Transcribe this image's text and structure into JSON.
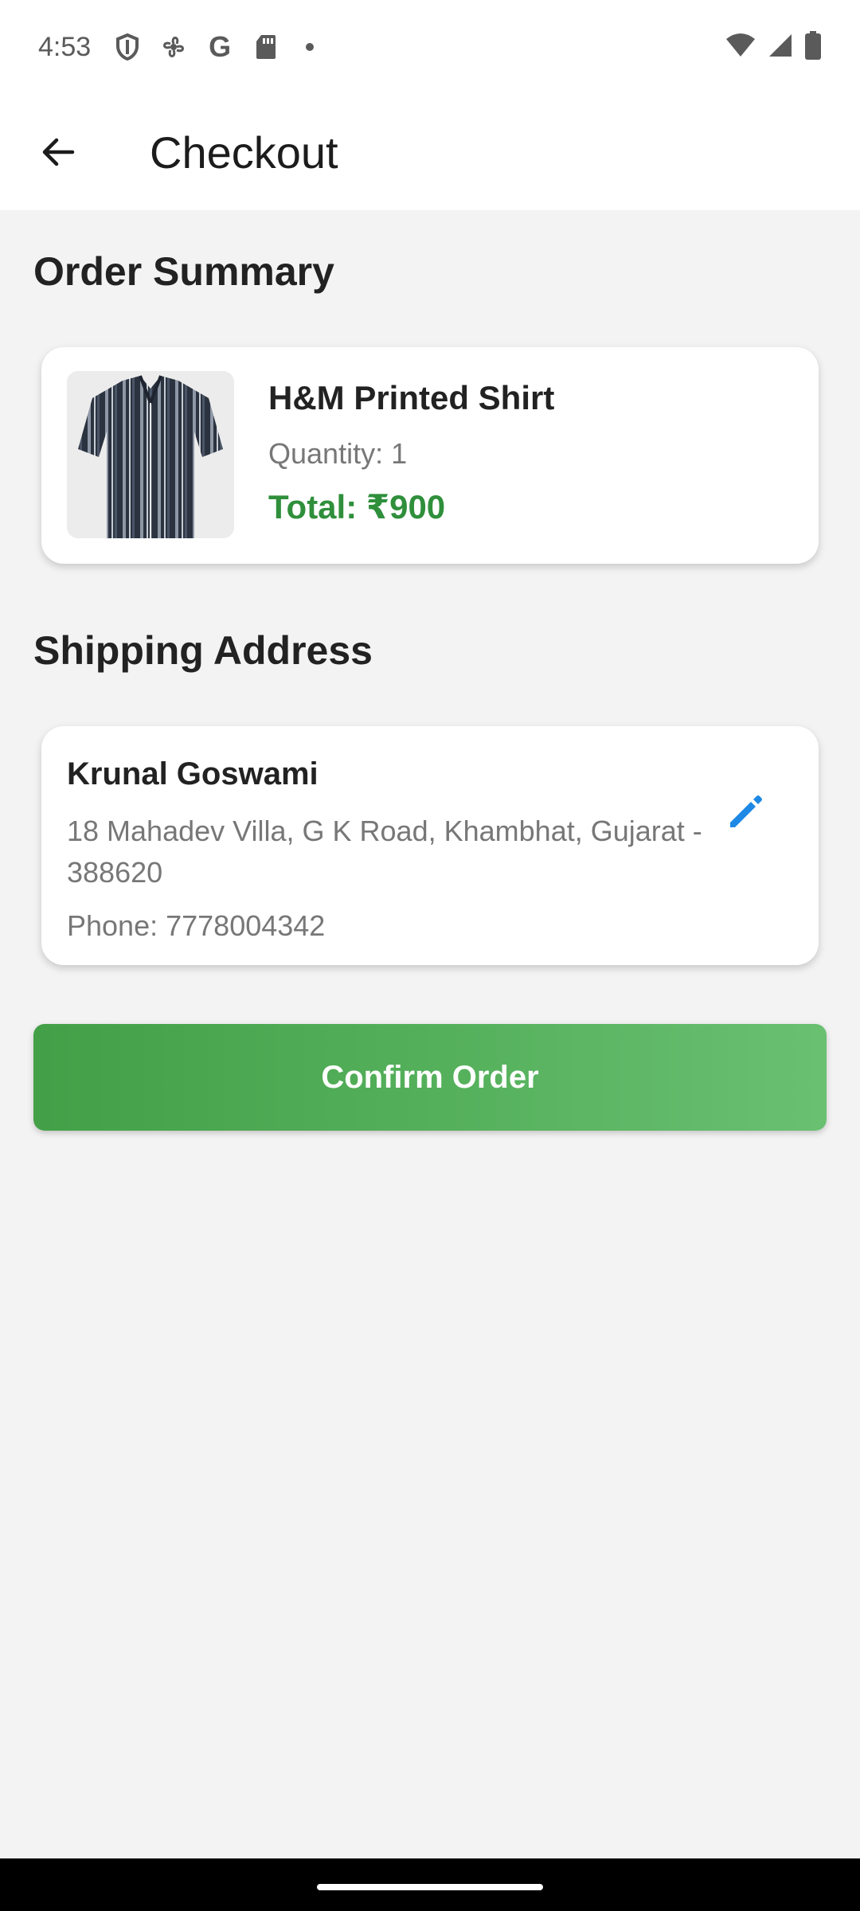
{
  "status_bar": {
    "time": "4:53",
    "icons_left": [
      "shield-icon",
      "pinwheel-icon",
      "google-icon",
      "sd-card-icon",
      "dot-icon"
    ],
    "icons_right": [
      "wifi-icon",
      "signal-icon",
      "battery-icon"
    ]
  },
  "app_bar": {
    "back_icon": "arrow-back-icon",
    "title": "Checkout"
  },
  "order_summary": {
    "heading": "Order Summary",
    "product": {
      "image": "striped-shirt",
      "name": "H&M Printed Shirt",
      "quantity": "Quantity: 1",
      "total": "Total: ₹900"
    }
  },
  "shipping": {
    "heading": "Shipping Address",
    "name": "Krunal Goswami",
    "address": "18 Mahadev Villa, G K Road, Khambhat, Gujarat - 388620",
    "phone": "Phone: 7778004342",
    "edit_icon": "pencil-icon"
  },
  "actions": {
    "confirm_label": "Confirm Order"
  },
  "colors": {
    "accent_green": "#2f8f3b",
    "button_green": "#4caf50",
    "edit_blue": "#1e88e5"
  }
}
